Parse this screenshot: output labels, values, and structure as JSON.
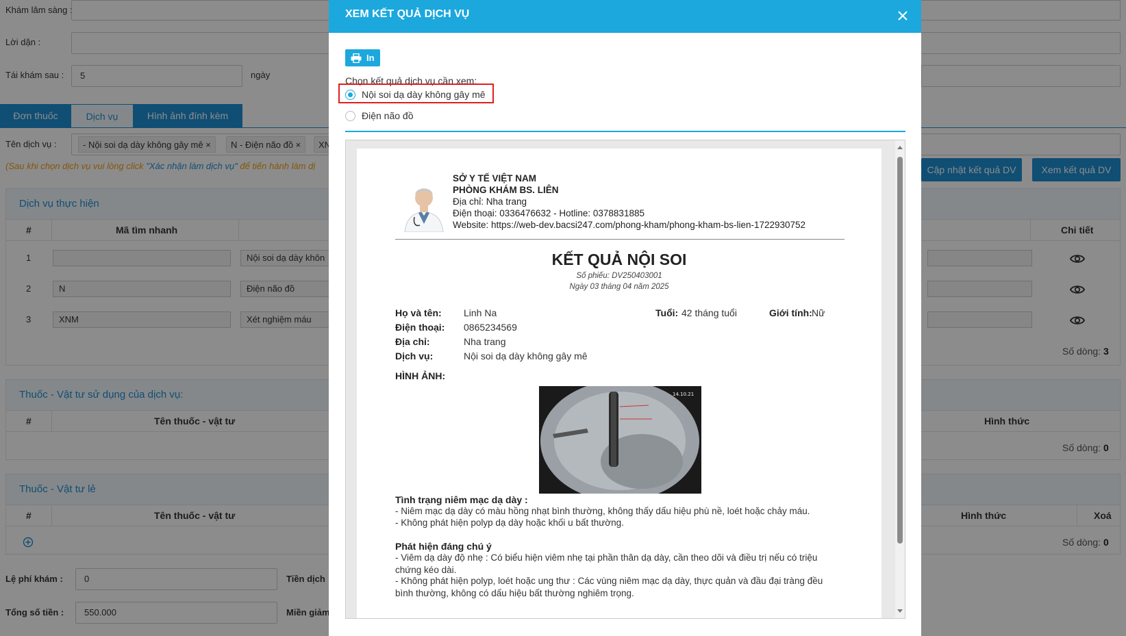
{
  "background": {
    "kham_lam_sang_label": "Khám lâm sàng :",
    "loi_dan_label": "Lời dặn :",
    "tai_kham_label": "Tái khám sau :",
    "tai_kham_value": "5",
    "tai_kham_unit": "ngày",
    "tabs": [
      "Đơn thuốc",
      "Dịch vụ",
      "Hình ảnh đính kèm"
    ],
    "ten_dich_vu_label": "Tên dịch vụ :",
    "chips": [
      "- Nội soi dạ dày không gây mê",
      "N - Điện não đồ",
      "XN"
    ],
    "note_prefix": "(Sau khi chọn dịch vụ vui lòng click ",
    "note_highlight": "\"Xác nhận làm dịch vụ\"",
    "note_suffix": " để tiến hành làm dị",
    "btn_update": "Cập nhật kết quả DV",
    "btn_view": "Xem kết quả DV",
    "panel1": {
      "title": "Dịch vụ thực hiện",
      "col_hash": "#",
      "col_code": "Mã tìm nhanh",
      "col_detail": "Chi tiết",
      "rows": [
        {
          "num": "1",
          "code": "",
          "name": "Nội soi dạ dày khôn"
        },
        {
          "num": "2",
          "code": "N",
          "name": "Điện não đồ"
        },
        {
          "num": "3",
          "code": "XNM",
          "name": "Xét nghiệm máu"
        }
      ],
      "count_label": "Số dòng:",
      "count_value": "3"
    },
    "panel2": {
      "title": "Thuốc - Vật tư sử dụng của dịch vụ:",
      "col_hash": "#",
      "col_name": "Tên thuốc - vật tư",
      "col_form": "Hình thức",
      "count_label": "Số dòng:",
      "count_value": "0"
    },
    "panel3": {
      "title": "Thuốc - Vật tư lẻ",
      "col_hash": "#",
      "col_name": "Tên thuốc - vật tư",
      "col_form": "Hình thức",
      "col_delete": "Xoá",
      "count_label": "Số dòng:",
      "count_value": "0"
    },
    "le_phi_label": "Lệ phí khám :",
    "le_phi_value": "0",
    "tien_dich_label": "Tiền dịch",
    "tong_so_tien_label": "Tổng số tiền :",
    "tong_so_tien_value": "550.000",
    "mien_giam_label": "Miền giảm"
  },
  "modal": {
    "title": "XEM KẾT QUẢ DỊCH VỤ",
    "print_label": "In",
    "choose_label": "Chọn kết quả dịch vụ cần xem:",
    "options": [
      {
        "label": "Nội soi dạ dày không gây mê",
        "selected": true
      },
      {
        "label": "Điện não đồ",
        "selected": false
      }
    ],
    "accent_color": "#1ca8dd"
  },
  "report": {
    "org1": "SỞ Y TẾ VIỆT NAM",
    "org2": "PHÒNG KHÁM BS. LIÊN",
    "address": "Địa chỉ: Nha trang",
    "phone": "Điện thoại: 0336476632 - Hotline: 0378831885",
    "website": "Website: https://web-dev.bacsi247.com/phong-kham/phong-kham-bs-lien-1722930752",
    "title": "KẾT QUẢ NỘI SOI",
    "ticket": "Số phiếu: DV250403001",
    "date": "Ngày 03 tháng 04 năm 2025",
    "name_label": "Họ và tên:",
    "name_value": "Linh Na",
    "age_label": "Tuổi:",
    "age_value": "42 tháng tuổi",
    "gender_label": "Giới tính:",
    "gender_value": "Nữ",
    "phone_label": "Điện thoại:",
    "phone_value": "0865234569",
    "addr_label": "Địa chỉ:",
    "addr_value": "Nha trang",
    "service_label": "Dịch vụ:",
    "service_value": "Nội soi dạ dày không gây mê",
    "images_label": "HÌNH ẢNH:",
    "xray_date": "14.10.21",
    "section1_title": "Tình trạng niêm mạc dạ dày :",
    "section1_line1": "- Niêm mạc dạ dày có màu hồng nhạt bình thường, không thấy dấu hiệu phù nề, loét hoặc chảy máu.",
    "section1_line2": "- Không phát hiện polyp dạ dày hoặc khối u bất thường.",
    "section2_title": "Phát hiện đáng chú ý",
    "section2_line1": "- Viêm dạ dày độ nhẹ : Có biểu hiện viêm nhẹ tại phần thân dạ dày, cần theo dõi và điều trị nếu có triệu chứng kéo dài.",
    "section2_line2": "- Không phát hiện polyp, loét hoặc ung thư : Các vùng niêm mạc dạ dày, thực quản và đầu đại tràng đều bình thường, không có dấu hiệu bất thường nghiêm trọng."
  }
}
